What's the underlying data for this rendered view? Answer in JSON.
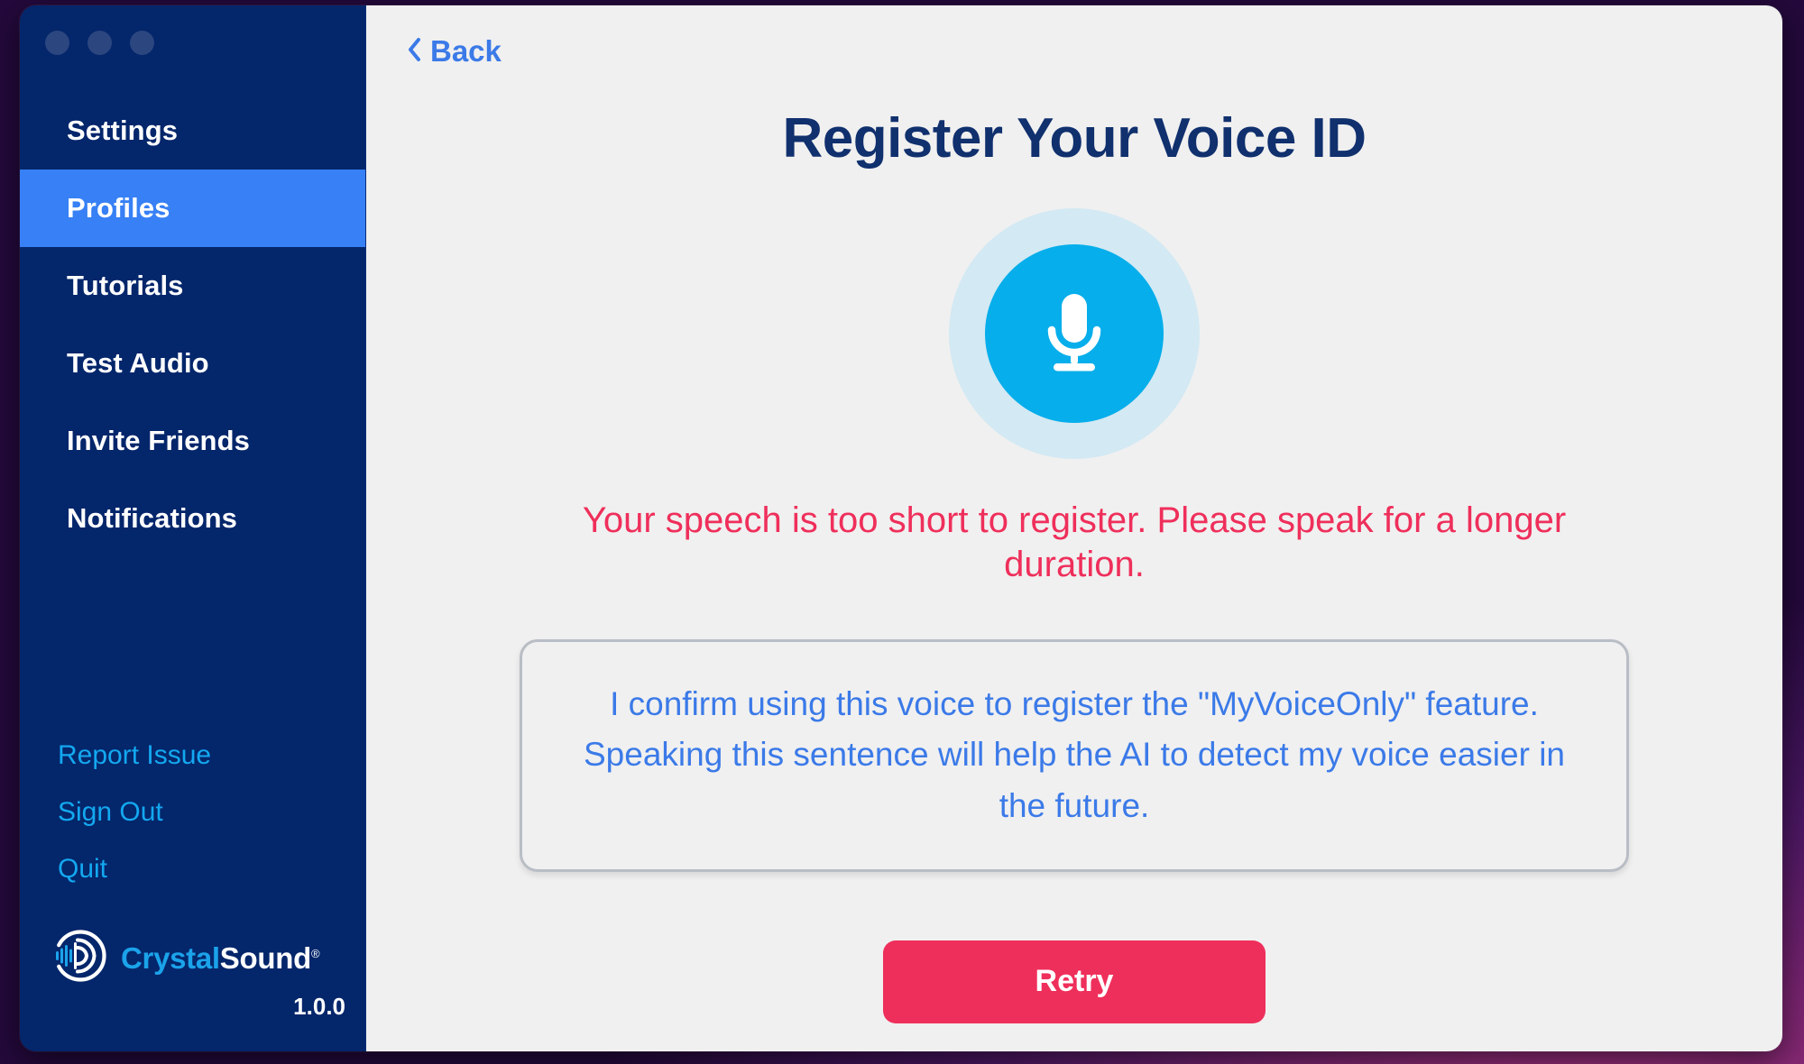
{
  "window": {
    "traffic_lights": [
      "close",
      "minimize",
      "maximize"
    ]
  },
  "sidebar": {
    "items": [
      {
        "label": "Settings",
        "active": false
      },
      {
        "label": "Profiles",
        "active": true
      },
      {
        "label": "Tutorials",
        "active": false
      },
      {
        "label": "Test Audio",
        "active": false
      },
      {
        "label": "Invite Friends",
        "active": false
      },
      {
        "label": "Notifications",
        "active": false
      }
    ],
    "footer_links": [
      {
        "label": "Report Issue"
      },
      {
        "label": "Sign Out"
      },
      {
        "label": "Quit"
      }
    ],
    "brand": {
      "name_part_1": "Crystal",
      "name_part_2": "Sound",
      "registered_mark": "®",
      "version": "1.0.0",
      "logo_icon": "sound-wave-circle-icon"
    },
    "colors": {
      "background": "#04266b",
      "active_item": "#3780f5",
      "footer_link": "#13a8f0",
      "brand_accent": "#1ba3ea"
    }
  },
  "main": {
    "back": {
      "label": "Back",
      "chevron": "‹",
      "icon": "chevron-left-icon"
    },
    "title": "Register Your Voice ID",
    "mic": {
      "icon": "microphone-icon",
      "halo_color": "#d3e9f3",
      "circle_color": "#06aeeb"
    },
    "error_message": "Your speech is too short to register. Please speak for a longer duration.",
    "phrase_box": {
      "text": "I confirm using this voice to register the \"MyVoiceOnly\" feature. Speaking this sentence will help the AI to detect my voice easier in the future.",
      "border_color": "#b9bdc5"
    },
    "retry_button": {
      "label": "Retry",
      "color": "#ef2f5b"
    },
    "colors": {
      "background": "#f0f0f0",
      "title": "#10306e",
      "link": "#3b7ae8",
      "error": "#ef2f5b"
    }
  }
}
